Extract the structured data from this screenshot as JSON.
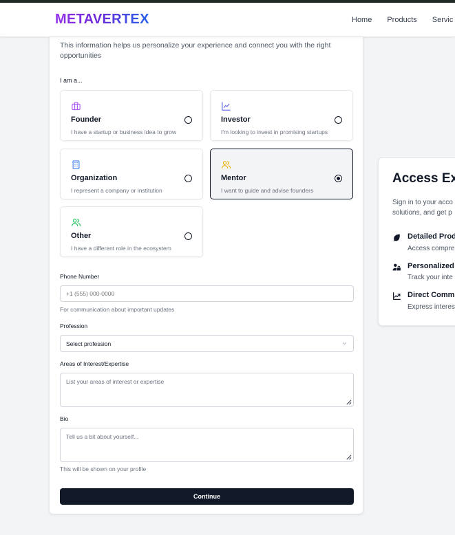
{
  "brand": {
    "logo": "METAVERTEX"
  },
  "nav": {
    "items": [
      "Home",
      "Products",
      "Servic"
    ]
  },
  "form": {
    "intro": "This information helps us personalize your experience and connect you with the right opportunities",
    "role_heading": "I am a...",
    "roles": [
      {
        "title": "Founder",
        "desc": "I have a startup or business idea to grow",
        "icon": "briefcase-icon",
        "selected": false
      },
      {
        "title": "Investor",
        "desc": "I'm looking to invest in promising startups",
        "icon": "line-chart-icon",
        "selected": false
      },
      {
        "title": "Organization",
        "desc": "I represent a company or institution",
        "icon": "building-icon",
        "selected": false
      },
      {
        "title": "Mentor",
        "desc": "I want to guide and advise founders",
        "icon": "users-icon",
        "selected": true
      },
      {
        "title": "Other",
        "desc": "I have a different role in the ecosystem",
        "icon": "users-icon",
        "selected": false
      }
    ],
    "phone": {
      "label": "Phone Number",
      "placeholder": "+1 (555) 000-0000",
      "hint": "For communication about important updates"
    },
    "profession": {
      "label": "Profession",
      "value": "Select profession"
    },
    "interests": {
      "label": "Areas of Interest/Expertise",
      "placeholder": "List your areas of interest or expertise"
    },
    "bio": {
      "label": "Bio",
      "placeholder": "Tell us a bit about yourself...",
      "hint": "This will be shown on your profile"
    },
    "continue_label": "Continue"
  },
  "side": {
    "title": "Access Ex",
    "intro_line1": "Sign in to your acco",
    "intro_line2": "solutions, and get p",
    "features": [
      {
        "title": "Detailed Prod",
        "desc": "Access compre",
        "icon": "leaf-icon"
      },
      {
        "title": "Personalized",
        "desc": "Track your inte",
        "icon": "user-lock-icon"
      },
      {
        "title": "Direct Comm",
        "desc": "Express interes",
        "icon": "trending-up-icon"
      }
    ]
  },
  "colors": {
    "accent_dark": "#111827",
    "founder_icon": "#a855f7",
    "investor_icon": "#6366f1",
    "organization_icon": "#3b82f6",
    "mentor_icon": "#eab308",
    "other_icon": "#22c55e"
  }
}
